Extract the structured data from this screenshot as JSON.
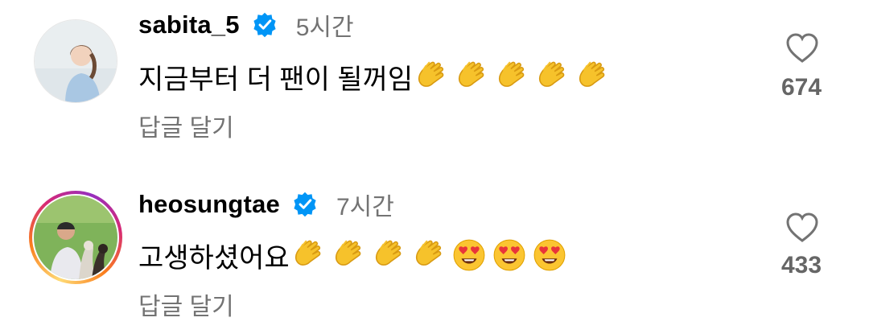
{
  "comments": [
    {
      "username": "sabita_5",
      "verified": true,
      "time": "5시간",
      "text": "지금부터 더 팬이 될꺼임",
      "emojis": [
        "clapping-hands",
        "clapping-hands",
        "clapping-hands",
        "clapping-hands",
        "clapping-hands"
      ],
      "reply_label": "답글 달기",
      "likes": "674",
      "avatar_story_ring": false
    },
    {
      "username": "heosungtae",
      "verified": true,
      "time": "7시간",
      "text": "고생하셨어요",
      "emojis": [
        "clapping-hands",
        "clapping-hands",
        "clapping-hands",
        "clapping-hands",
        "heart-eyes-face",
        "heart-eyes-face",
        "heart-eyes-face"
      ],
      "reply_label": "답글 달기",
      "likes": "433",
      "avatar_story_ring": true
    }
  ],
  "colors": {
    "verified": "#0095f6",
    "secondary_text": "#737373",
    "likes": "#666666"
  }
}
